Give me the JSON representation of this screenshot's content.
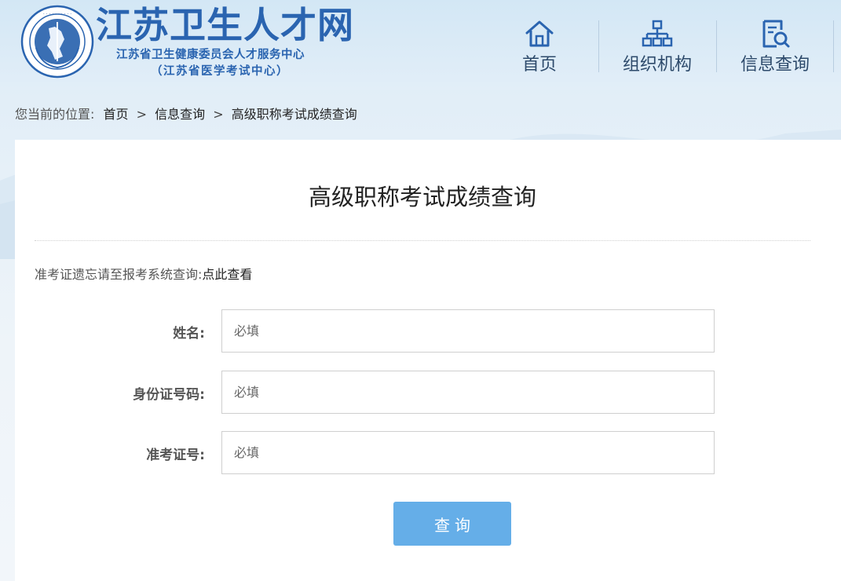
{
  "header": {
    "title": "江苏卫生人才网",
    "subtitle_1": "江苏省卫生健康委员会人才服务中心",
    "subtitle_2": "（江苏省医学考试中心）",
    "logo_ring_text": "江苏省卫生健康委员会人才服务中心",
    "logo_icon": "emblem-icon"
  },
  "nav": [
    {
      "label": "首页",
      "icon": "home-icon"
    },
    {
      "label": "组织机构",
      "icon": "org-chart-icon"
    },
    {
      "label": "信息查询",
      "icon": "search-document-icon"
    }
  ],
  "breadcrumb": {
    "prefix": "您当前的位置:",
    "home": "首页",
    "section": "信息查询",
    "current": "高级职称考试成绩查询",
    "separator": ">"
  },
  "page": {
    "title": "高级职称考试成绩查询",
    "notice_text": "准考证遗忘请至报考系统查询:",
    "notice_link": "点此查看"
  },
  "form": {
    "name_label": "姓名:",
    "name_placeholder": "必填",
    "id_label": "身份证号码:",
    "id_placeholder": "必填",
    "ticket_label": "准考证号:",
    "ticket_placeholder": "必填",
    "submit_label": "查询"
  },
  "colors": {
    "brand_blue": "#2a64b0",
    "button_blue": "#65aee8",
    "nav_text": "#2d4a6b"
  }
}
